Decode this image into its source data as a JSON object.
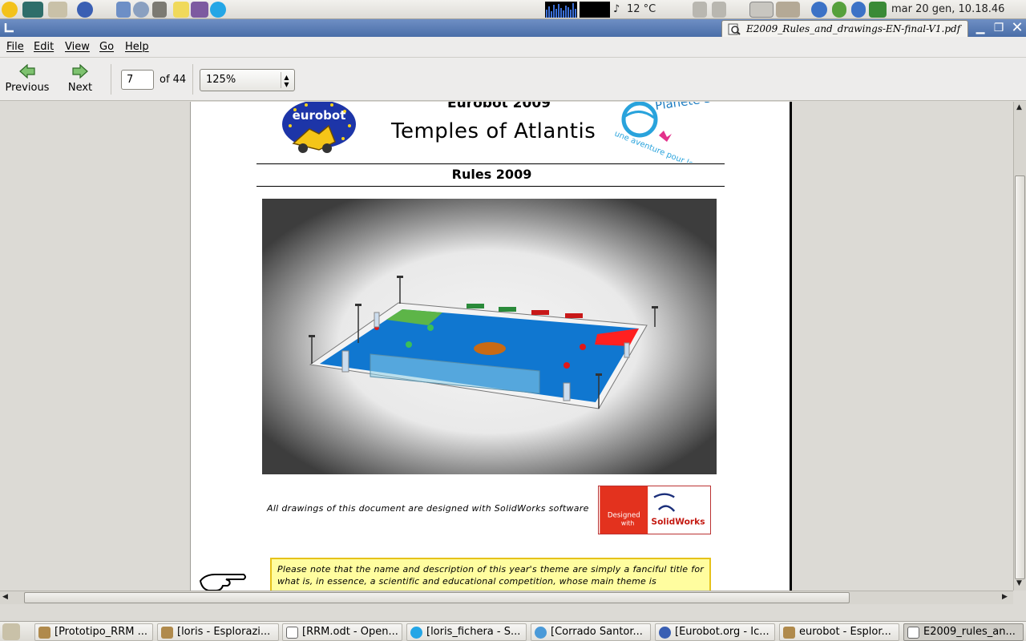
{
  "system": {
    "temperature": "12 °C",
    "datetime": "mar 20 gen, 10.18.46"
  },
  "window": {
    "title": "E2009_Rules_and_drawings-EN-final-V1.pdf"
  },
  "menu": {
    "file": "File",
    "edit": "Edit",
    "view": "View",
    "go": "Go",
    "help": "Help"
  },
  "toolbar": {
    "previous_label": "Previous",
    "next_label": "Next",
    "page_value": "7",
    "page_total_text": "of 44",
    "zoom": "125%"
  },
  "document": {
    "header_top": "Eurobot 2009",
    "logo_left_text": "eurobot",
    "logo_right_text": "Planète Sciences",
    "logo_right_tagline": "une aventure pour les jeunes",
    "title": "Temples of Atlantis",
    "subtitle": "Rules 2009",
    "drawing_note": "All drawings of this document are designed with SolidWorks software",
    "solidworks_badge": {
      "designed": "Designed",
      "with": "with",
      "brand": "SolidWorks"
    },
    "notice": "Please note that the name and description of this year's theme are simply a fanciful title for what is, in essence, a scientific and educational competition, whose main theme is"
  },
  "taskbar": {
    "tasks": [
      "[Prototipo_RRM ...",
      "[loris - Esplorazi...",
      "[RRM.odt - Open...",
      "[loris_fichera - S...",
      "[Corrado Santor...",
      "[Eurobot.org - Ic...",
      "eurobot - Esplor...",
      "E2009_rules_an..."
    ]
  },
  "colors": {
    "table_blue": "#1077d0",
    "start_green": "#5db548",
    "start_red": "#ff2020",
    "notice_bg": "#fffd9f",
    "title_bar": "#4a6ea8"
  }
}
